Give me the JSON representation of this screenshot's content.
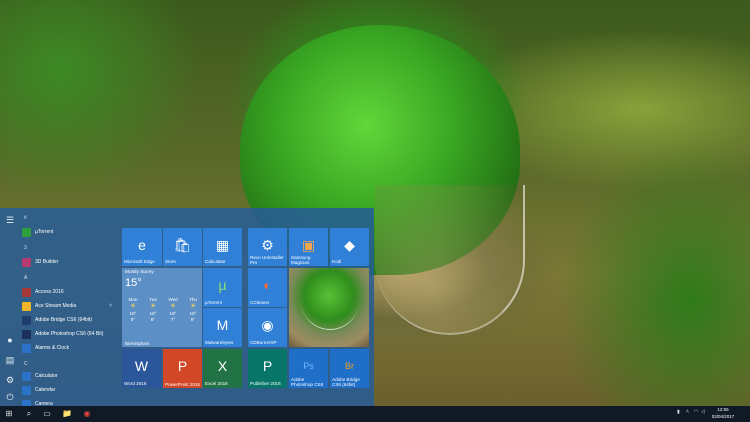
{
  "rail": {
    "icons": [
      "hamburger-icon",
      "user-icon",
      "document-icon",
      "settings-icon",
      "power-icon"
    ]
  },
  "apps": {
    "groups": [
      {
        "letter": "#",
        "items": [
          {
            "label": "µTorrent",
            "color": "#2f9e3c"
          }
        ]
      },
      {
        "letter": "3",
        "items": [
          {
            "label": "3D Builder",
            "color": "#b43a6f"
          }
        ]
      },
      {
        "letter": "A",
        "items": [
          {
            "label": "Access 2016",
            "color": "#a4373a"
          },
          {
            "label": "Ace Stream Media",
            "color": "#f0b429",
            "expand": "˅"
          },
          {
            "label": "Adobe Bridge CS6 (64bit)",
            "color": "#1f3d6e"
          },
          {
            "label": "Adobe Photoshop CS6 (64 Bit)",
            "color": "#1b2f5a"
          },
          {
            "label": "Alarms & Clock",
            "color": "#2b73c8"
          }
        ]
      },
      {
        "letter": "C",
        "items": [
          {
            "label": "Calculator",
            "color": "#2b73c8"
          },
          {
            "label": "Calendar",
            "color": "#2b73c8"
          },
          {
            "label": "Camera",
            "color": "#2b73c8"
          }
        ]
      }
    ]
  },
  "tiles": {
    "edge": {
      "label": "Microsoft Edge",
      "glyph": "e"
    },
    "store": {
      "label": "Store",
      "glyph": "🛍"
    },
    "calculator": {
      "label": "Calculator",
      "glyph": "▦"
    },
    "revo": {
      "label": "Revo Uninstaller Pro",
      "glyph": "⚙"
    },
    "samsung": {
      "label": "Samsung Magician",
      "glyph": "▣"
    },
    "kodi": {
      "label": "Kodi",
      "glyph": "◆"
    },
    "weather": {
      "city": "Mostly Sunny",
      "temp": "15°",
      "days": [
        {
          "day": "Mon",
          "icon": "☀",
          "hi": "18°",
          "lo": "9°"
        },
        {
          "day": "Tue",
          "icon": "☀",
          "hi": "18°",
          "lo": "8°"
        },
        {
          "day": "Wed",
          "icon": "☀",
          "hi": "18°",
          "lo": "7°"
        },
        {
          "day": "Thu",
          "icon": "☀",
          "hi": "18°",
          "lo": "9°"
        }
      ],
      "place": "Birmingham"
    },
    "utorrent": {
      "label": "µTorrent",
      "glyph": "µ"
    },
    "ccleaner": {
      "label": "CCleaner",
      "glyph": "◐"
    },
    "malwarebytes": {
      "label": "Malwarebytes",
      "glyph": "M"
    },
    "cdburner": {
      "label": "CDBurnerXP",
      "glyph": "◉"
    },
    "word": {
      "label": "Word 2016",
      "glyph": "W",
      "color": "#2b579a"
    },
    "powerpoint": {
      "label": "PowerPoint 2016",
      "glyph": "P",
      "color": "#d24726"
    },
    "excel": {
      "label": "Excel 2016",
      "glyph": "X",
      "color": "#217346"
    },
    "publisher": {
      "label": "Publisher 2016",
      "glyph": "P",
      "color": "#077568"
    },
    "photoshop": {
      "label": "Adobe Photoshop CS6",
      "glyph": "Ps",
      "color": "#1c3d6e"
    },
    "bridge": {
      "label": "Adobe Bridge CS6 (64bit)",
      "glyph": "Br",
      "color": "#1f3d6e"
    }
  },
  "taskbar": {
    "start": "⊞",
    "search": "⌕",
    "taskview": "▭",
    "explorer": "📁",
    "chrome": "◉",
    "time": "12:55",
    "date": "02/04/2017"
  },
  "colors": {
    "start_bg": "#265c96",
    "tile_blue": "#2f80d6",
    "taskbar": "#0f1a26"
  }
}
